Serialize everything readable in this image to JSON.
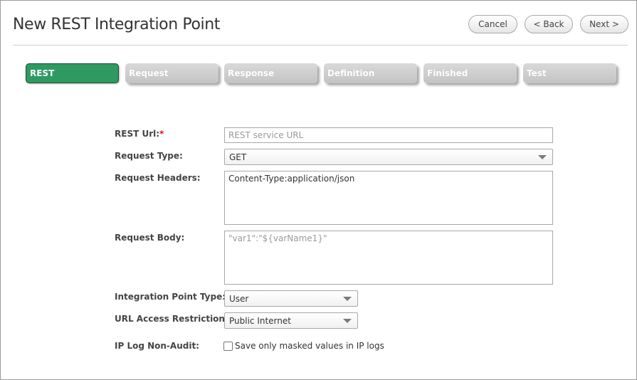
{
  "header": {
    "title": "New REST Integration Point",
    "cancel_label": "Cancel",
    "back_label": "< Back",
    "next_label": "Next >"
  },
  "steps": [
    {
      "label": "REST",
      "active": true
    },
    {
      "label": "Request",
      "active": false
    },
    {
      "label": "Response",
      "active": false
    },
    {
      "label": "Definition",
      "active": false
    },
    {
      "label": "Finished",
      "active": false
    },
    {
      "label": "Test",
      "active": false
    }
  ],
  "form": {
    "rest_url": {
      "label": "REST Url:",
      "required_mark": "*",
      "value": "",
      "placeholder": "REST service URL"
    },
    "request_type": {
      "label": "Request Type:",
      "value": "GET"
    },
    "request_headers": {
      "label": "Request Headers:",
      "value": "Content-Type:application/json"
    },
    "request_body": {
      "label": "Request Body:",
      "value": "",
      "placeholder": "\"var1\":\"${varName1}\""
    },
    "integration_point_type": {
      "label": "Integration Point Type:",
      "value": "User"
    },
    "url_access_restriction": {
      "label": "URL Access Restriction:",
      "value": "Public Internet"
    },
    "ip_log_non_audit": {
      "label": "IP Log Non-Audit:",
      "checkbox_label": "Save only masked values in IP logs",
      "checked": false
    }
  },
  "colors": {
    "active_step": "#2e9a61",
    "inactive_step": "#cfcfcf",
    "required": "#dd1111"
  }
}
